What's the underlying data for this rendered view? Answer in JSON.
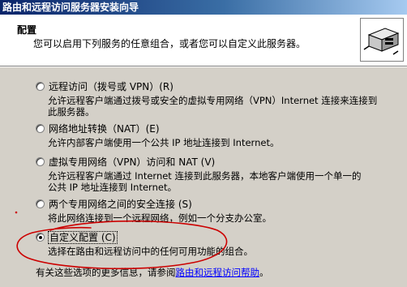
{
  "window": {
    "title": "路由和远程访问服务器安装向导"
  },
  "header": {
    "title": "配置",
    "subtitle": "您可以启用下列服务的任意组合，或者您可以自定义此服务器。",
    "icon": "network-server-icon"
  },
  "options": [
    {
      "label": "远程访问（拨号或 VPN）(R)",
      "desc": [
        "允许远程客户端通过拨号或安全的虚拟专用网络（VPN）Internet 连接来连接到",
        "此服务器。"
      ],
      "selected": false
    },
    {
      "label": "网络地址转换（NAT）(E)",
      "desc": [
        "允许内部客户端使用一个公共 IP 地址连接到 Internet。"
      ],
      "selected": false
    },
    {
      "label": "虚拟专用网络（VPN）访问和 NAT (V)",
      "desc": [
        "允许远程客户端通过 Internet 连接到此服务器，本地客户端使用一个单一的",
        "公共 IP 地址连接到 Internet。"
      ],
      "selected": false
    },
    {
      "label": "两个专用网络之间的安全连接 (S)",
      "desc": [
        "将此网络连接到一个远程网络，例如一个分支办公室。"
      ],
      "selected": false
    },
    {
      "label": "自定义配置 (C)",
      "desc": [
        "选择在路由和远程访问中的任何可用功能的组合。"
      ],
      "selected": true
    }
  ],
  "footer": {
    "text": "有关这些选项的更多信息，请参阅",
    "link": "路由和远程访问帮助",
    "suffix": "。"
  },
  "colors": {
    "annotation": "#cc0000",
    "link": "#0000ff"
  }
}
